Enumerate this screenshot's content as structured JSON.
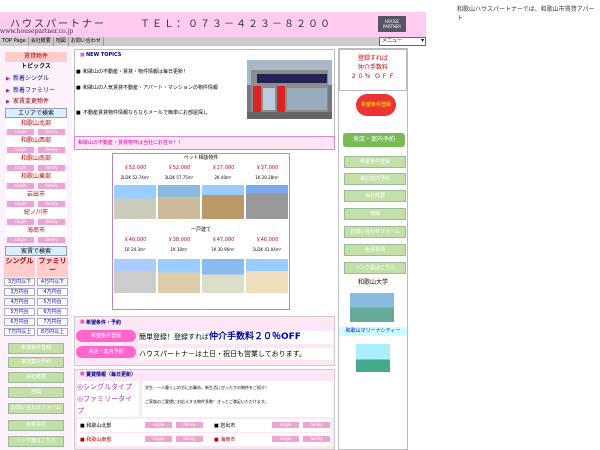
{
  "page_title_top_right": "和歌山ハウスパートナーでは、和歌山市賃貸アパート",
  "header": {
    "brand": "ハウスパートナー",
    "tel": "ＴＥＬ：０７３－４２３－８２００",
    "logo_text": "HOUSE PARTNER",
    "domain": "www.housepartner.co.jp"
  },
  "topnav": [
    "TOP Page",
    "会社概要",
    "地図",
    "お問い合わせ"
  ],
  "menu_select": "メニュー",
  "left_sidebar": {
    "top_btn": "賃貸物件",
    "topics": "トピックス",
    "arrow_items": [
      "新着シングル",
      "新着ファミリー",
      "家賃変更物件"
    ],
    "area_search_title": "エリアで検索",
    "areas": [
      "和歌山北部",
      "和歌山西部",
      "和歌山南部",
      "和歌山東部",
      "岩出市",
      "紀ノ川市",
      "海南市"
    ],
    "pill_single": "single",
    "pill_family": "family",
    "rent_search_title": "家賃で検索",
    "single_col": "シングル",
    "family_col": "ファミリー",
    "single_prices": [
      "3万円以下",
      "3万円台",
      "4万円台",
      "5万円台",
      "6万円台",
      "7万円以上"
    ],
    "family_prices": [
      "4万円以下",
      "4万円台",
      "5万円台",
      "6万円台",
      "7万円台",
      "8万円以上"
    ],
    "green_buttons": [
      "希望条件登録",
      "来店案内予約",
      "会社概要",
      "地図",
      "お問い合わせフォーム",
      "免責事項",
      "リンク集はこちら"
    ]
  },
  "new_topics": {
    "title": "NEW TOPICS",
    "bullets": [
      "和歌山の不動産・賃貸・物件情報は毎日更新！",
      "和歌山の人気賃貸不動産・アパート・マンションの物件情報",
      "不動産賃貸物件情報ならならメールで簡単にお部屋探し"
    ],
    "banner": "和歌山の不動産・賃貸物件は当社にお任せ！！"
  },
  "listings": {
    "pet_header": "ペット相談物件",
    "house_header": "一戸建て",
    "pet": [
      {
        "price": "￥52,000",
        "specs": "2LDK 52.74m²"
      },
      {
        "price": "￥52,000",
        "specs": "3LDK 57.75m²"
      },
      {
        "price": "￥27,000",
        "specs": "2K 40m²"
      },
      {
        "price": "￥37,000",
        "specs": "1K 20.28m²"
      }
    ],
    "house": [
      {
        "price": "￥40,000",
        "specs": "1R 24.3m²"
      },
      {
        "price": "￥38,000",
        "specs": "1K 30m²"
      },
      {
        "price": "￥47,000",
        "specs": "1K 30.96m²"
      },
      {
        "price": "￥46,000",
        "specs": "1LDK 41.04m²"
      }
    ]
  },
  "conditions": {
    "title": "希望条件・予約",
    "btn1": "希望条件登録",
    "btn2": "来店・案内予約",
    "line1_prefix": "簡単登録！登録すれば",
    "line1_emph": "仲介手数料２０％OFF",
    "line2": "ハウスパートナ－は土日・祝日も営業しております。"
  },
  "rent_info": {
    "title": "賃貸情報（毎日更新）",
    "single_type": "◎シングルタイプ",
    "family_type": "◎ファミリータイプ",
    "single_desc": "学生・一人暮らしの方にお薦め。新生活にぴったりの物件をご紹介！",
    "family_desc": "ご家族のご要望にお応えする物件多数！きっとご満足いただけます。",
    "rows": [
      [
        "和歌山北部",
        "岩出市"
      ],
      [
        "和歌山南部",
        "海南市"
      ]
    ],
    "pill_single": "single",
    "pill_family": "family"
  },
  "right_sidebar": {
    "promo": [
      "登録すれば",
      "仲介手数料",
      "２０％ ＯＦＦ"
    ],
    "promo_badge": "希望条件登録",
    "reserve_btn": "来店・案内予約",
    "buttons": [
      "希望条件登録",
      "来店案内予約",
      "会社概要",
      "地図",
      "お問い合わせフォーム",
      "免責事項",
      "リンク集はこちら"
    ],
    "university": "和歌山大学",
    "marina": "和歌山マリーナシティー"
  },
  "colors": {
    "header_pink": "#ffccf0",
    "accent_red": "#c00000",
    "green_btn": "#c4e0a8",
    "sidebar_bg": "#fdf2fb"
  }
}
